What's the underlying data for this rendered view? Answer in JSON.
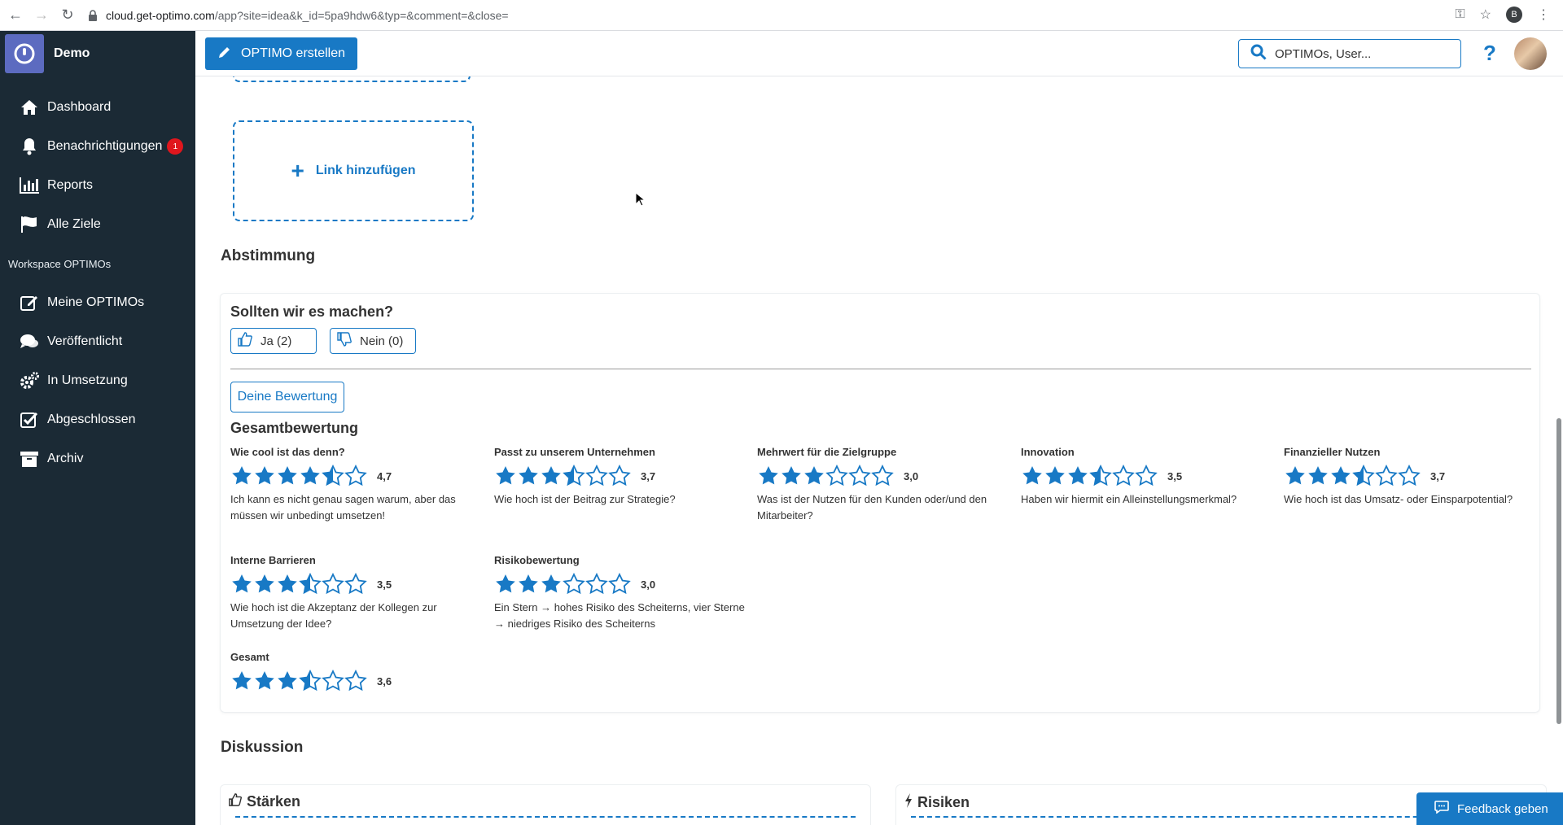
{
  "browser": {
    "url_host": "cloud.get-optimo.com",
    "url_path": "/app?site=idea&k_id=5pa9hdw6&typ=&comment=&close=",
    "profile_initial": "B"
  },
  "sidebar": {
    "brand": "Demo",
    "items": [
      {
        "label": "Dashboard",
        "icon": "home-icon"
      },
      {
        "label": "Benachrichtigungen",
        "icon": "bell-icon",
        "badge": "1"
      },
      {
        "label": "Reports",
        "icon": "bar-chart-icon"
      },
      {
        "label": "Alle Ziele",
        "icon": "flag-icon"
      }
    ],
    "section_label": "Workspace OPTIMOs",
    "workspace_items": [
      {
        "label": "Meine OPTIMOs",
        "icon": "edit-icon"
      },
      {
        "label": "Veröffentlicht",
        "icon": "comments-icon"
      },
      {
        "label": "In Umsetzung",
        "icon": "gears-icon"
      },
      {
        "label": "Abgeschlossen",
        "icon": "check-square-icon"
      },
      {
        "label": "Archiv",
        "icon": "archive-icon"
      }
    ]
  },
  "topbar": {
    "create_label": "OPTIMO erstellen",
    "search_placeholder": "OPTIMOs, User...",
    "help_label": "?"
  },
  "links": {
    "add_label": "Link hinzufügen"
  },
  "voting": {
    "section_title": "Abstimmung",
    "question": "Sollten wir es machen?",
    "yes_label": "Ja (2)",
    "no_label": "Nein (0)",
    "own_rating_label": "Deine Bewertung",
    "overall_title": "Gesamtbewertung",
    "criteria": [
      {
        "name": "Wie cool ist das denn?",
        "rating": 4.7,
        "value": "4,7",
        "desc": "Ich kann es nicht genau sagen warum, aber das müssen wir unbedingt umsetzen!"
      },
      {
        "name": "Passt zu unserem Unternehmen",
        "rating": 3.7,
        "value": "3,7",
        "desc": "Wie hoch ist der Beitrag zur Strategie?"
      },
      {
        "name": "Mehrwert für die Zielgruppe",
        "rating": 3.0,
        "value": "3,0",
        "desc": "Was ist der Nutzen für den Kunden oder/und den Mitarbeiter?"
      },
      {
        "name": "Innovation",
        "rating": 3.5,
        "value": "3,5",
        "desc": "Haben wir hiermit ein Alleinstellungsmerkmal?"
      },
      {
        "name": "Finanzieller Nutzen",
        "rating": 3.7,
        "value": "3,7",
        "desc": "Wie hoch ist das Umsatz- oder Einsparpotential?"
      },
      {
        "name": "Interne Barrieren",
        "rating": 3.5,
        "value": "3,5",
        "desc": "Wie hoch ist die Akzeptanz der Kollegen zur Umsetzung der Idee?"
      },
      {
        "name": "Risikobewertung",
        "rating": 3.0,
        "value": "3,0",
        "desc": "Ein Stern → hohes Risiko des Scheiterns, vier Sterne → niedriges Risiko des Scheiterns"
      }
    ],
    "total": {
      "name": "Gesamt",
      "rating": 3.6,
      "value": "3,6"
    }
  },
  "discussion": {
    "section_title": "Diskussion",
    "strengths_label": "Stärken",
    "risks_label": "Risiken"
  },
  "feedback_label": "Feedback geben",
  "colors": {
    "accent": "#1879c5",
    "sidebar_bg": "#1b2a35",
    "badge": "#e0161d"
  }
}
